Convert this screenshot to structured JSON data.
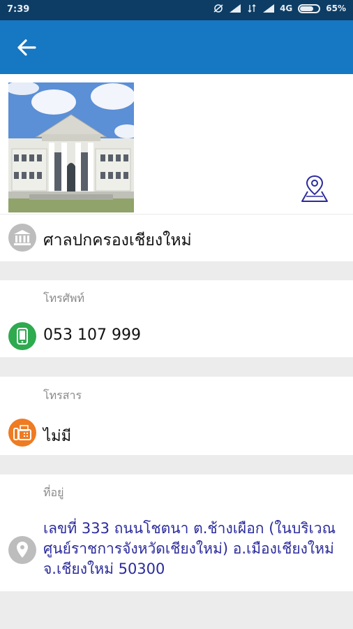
{
  "status_bar": {
    "time": "7:39",
    "network": "4G",
    "battery": "65%"
  },
  "app_bar": {
    "back_icon": "arrow-left-icon"
  },
  "place": {
    "name": "ศาลปกครองเชียงใหม่",
    "photo": "court-building-photo",
    "map_icon": "map-pin-icon"
  },
  "phone": {
    "label": "โทรศัพท์",
    "value": "053 107 999"
  },
  "fax": {
    "label": "โทรสาร",
    "value": "ไม่มี"
  },
  "address": {
    "label": "ที่อยู่",
    "value": "เลขที่ 333 ถนนโชตนา ต.ช้างเผือก (ในบริเวณศูนย์ราชการจังหวัดเชียงใหม่) อ.เมืองเชียงใหม่ จ.เชียงใหม่ 50300"
  },
  "colors": {
    "status_bar": "#0d3d64",
    "app_bar": "#1677c2",
    "phone_icon": "#2eaa4f",
    "fax_icon": "#ef7b22",
    "address_text": "#2b2b9e",
    "map_icon": "#2b2b9e"
  }
}
